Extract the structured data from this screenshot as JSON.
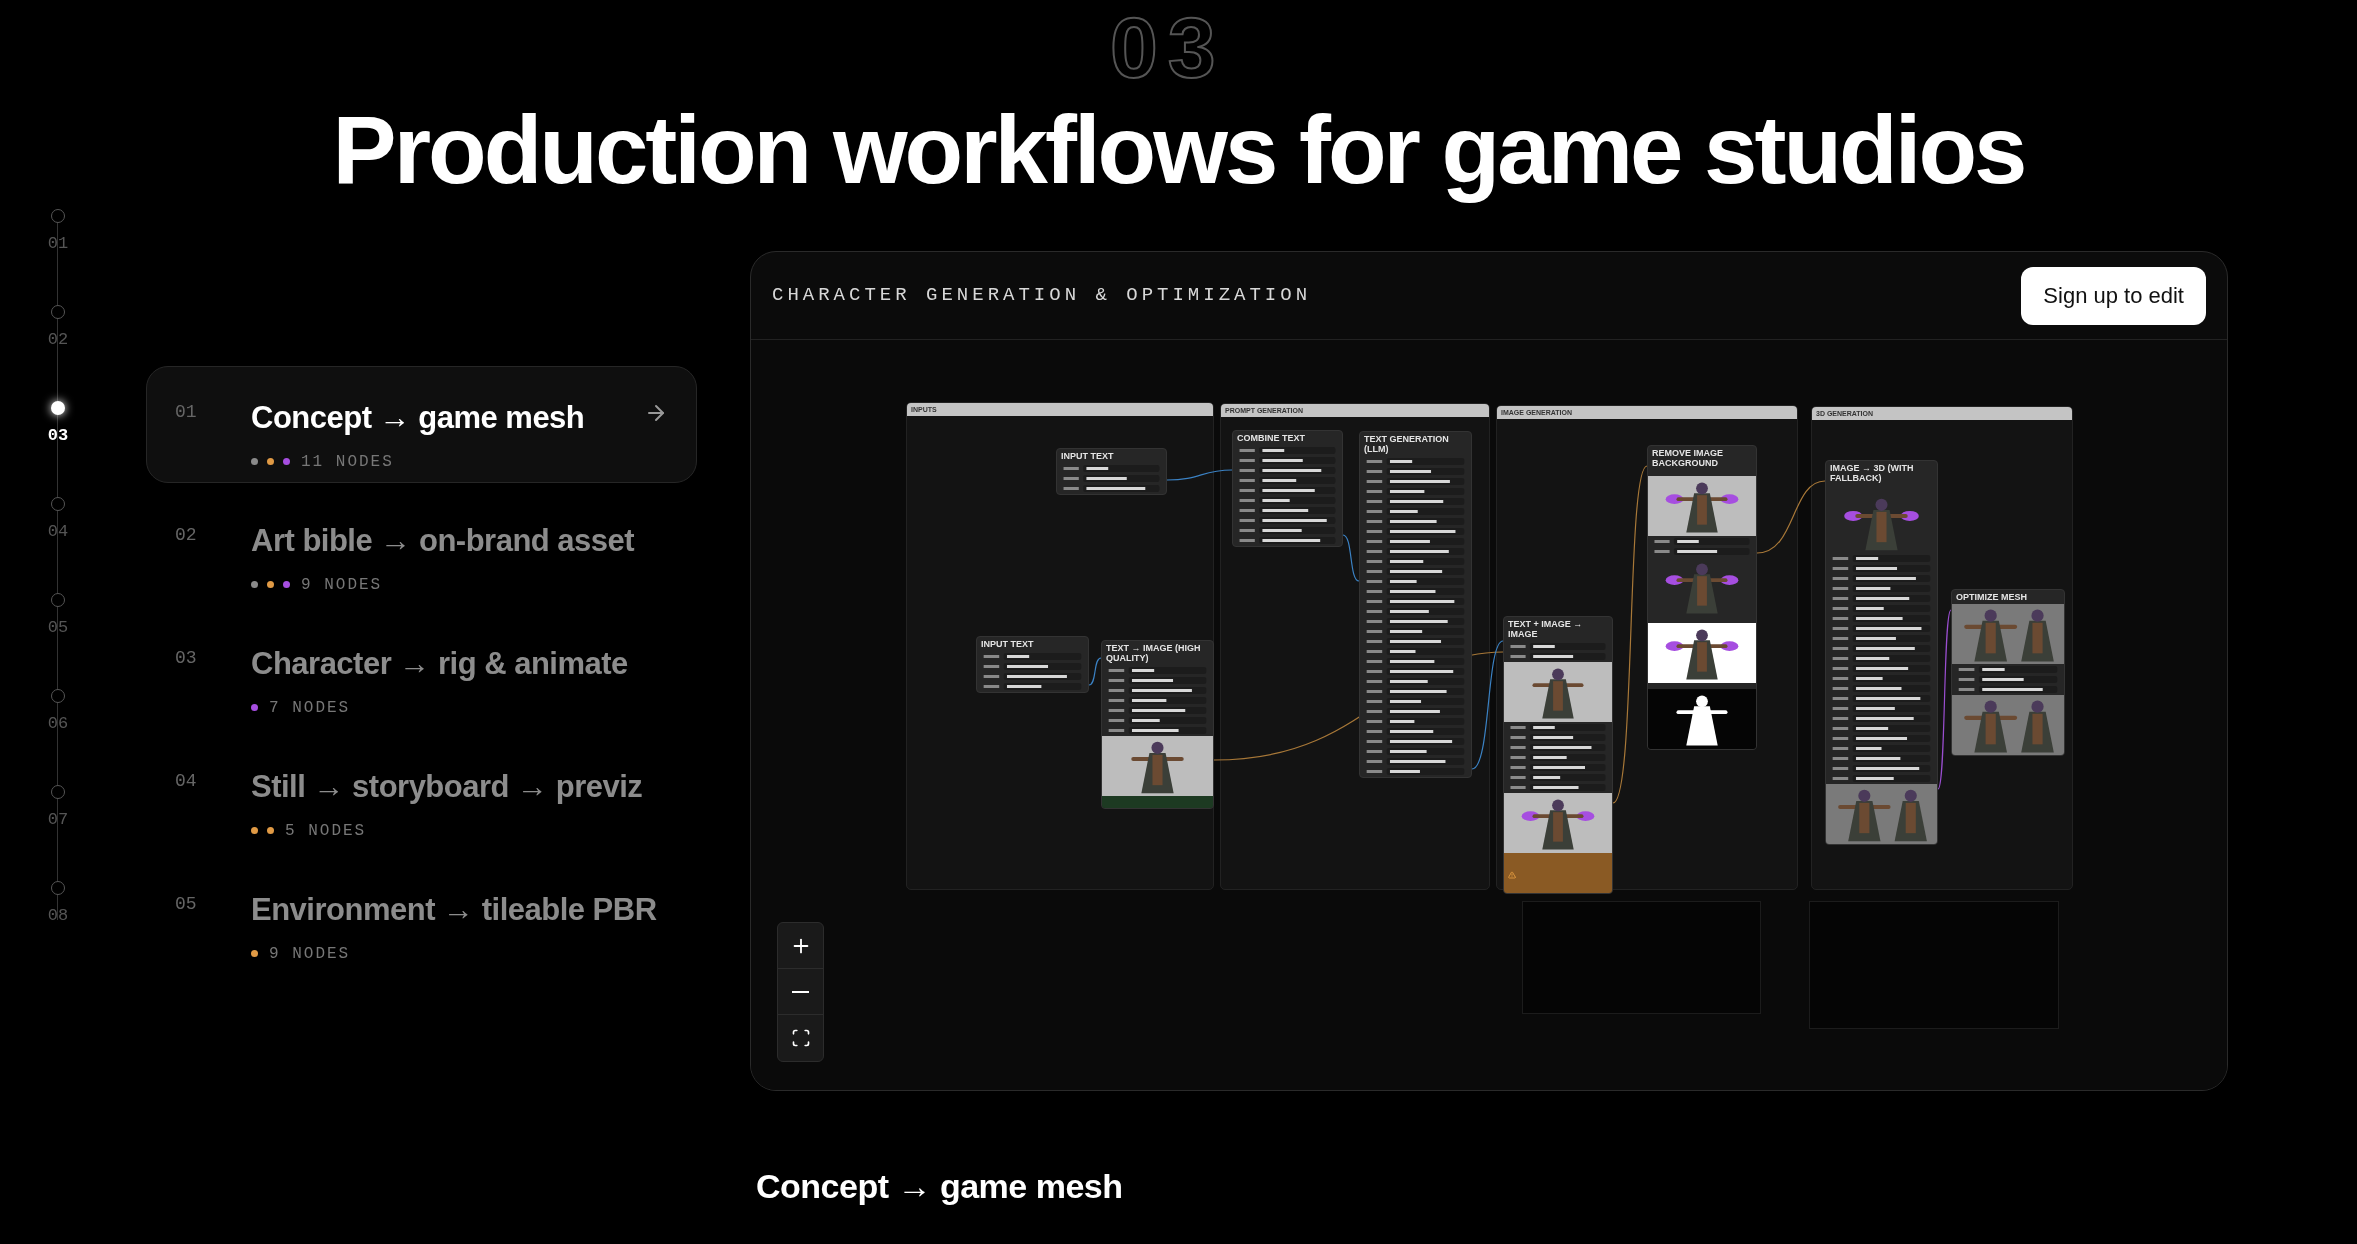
{
  "heading": "Production workflows for game studios",
  "background_numeral": "03",
  "steps": [
    {
      "label": "01",
      "selected": false
    },
    {
      "label": "02",
      "selected": false
    },
    {
      "label": "03",
      "selected": true
    },
    {
      "label": "04",
      "selected": false
    },
    {
      "label": "05",
      "selected": false
    },
    {
      "label": "06",
      "selected": false
    },
    {
      "label": "07",
      "selected": false
    },
    {
      "label": "08",
      "selected": false
    }
  ],
  "workflows": [
    {
      "number": "01",
      "title": "Concept → game mesh",
      "dots": [
        {
          "color": "#8a8a8a"
        },
        {
          "color": "#e09a45"
        },
        {
          "color": "#a64ee0"
        }
      ],
      "count": "11 NODES",
      "selected": true
    },
    {
      "number": "02",
      "title": "Art bible → on-brand asset",
      "dots": [
        {
          "color": "#8a8a8a"
        },
        {
          "color": "#e09a45"
        },
        {
          "color": "#a64ee0"
        }
      ],
      "count": "9 NODES",
      "selected": false
    },
    {
      "number": "03",
      "title": "Character → rig & animate",
      "dots": [
        {
          "color": "#a64ee0"
        }
      ],
      "count": "7 NODES",
      "selected": false
    },
    {
      "number": "04",
      "title": "Still → storyboard → previz",
      "dots": [
        {
          "color": "#e09a45"
        },
        {
          "color": "#e09a45"
        }
      ],
      "count": "5 NODES",
      "selected": false
    },
    {
      "number": "05",
      "title": "Environment → tileable PBR",
      "dots": [
        {
          "color": "#e09a45"
        }
      ],
      "count": "9 NODES",
      "selected": false
    }
  ],
  "editor": {
    "title": "CHARACTER GENERATION & OPTIMIZATION",
    "button": "Sign up to edit",
    "groups": [
      {
        "title": "INPUTS",
        "nodes": [
          {
            "title": "INPUT TEXT",
            "kind": "text"
          },
          {
            "title": "INPUT TEXT",
            "kind": "text"
          },
          {
            "title": "TEXT → IMAGE (HIGH QUALITY)"
          }
        ]
      },
      {
        "title": "PROMPT GENERATION",
        "nodes": [
          {
            "title": "COMBINE TEXT",
            "kind": "text"
          },
          {
            "title": "TEXT GENERATION (LLM)",
            "kind": "text"
          }
        ]
      },
      {
        "title": "IMAGE GENERATION",
        "nodes": [
          {
            "title": "TEXT + IMAGE → IMAGE"
          },
          {
            "title": "REMOVE IMAGE BACKGROUND"
          }
        ]
      },
      {
        "title": "3D GENERATION",
        "nodes": [
          {
            "title": "IMAGE → 3D (WITH FALLBACK)"
          },
          {
            "title": "OPTIMIZE MESH"
          }
        ]
      }
    ]
  },
  "caption": "Concept → game mesh"
}
